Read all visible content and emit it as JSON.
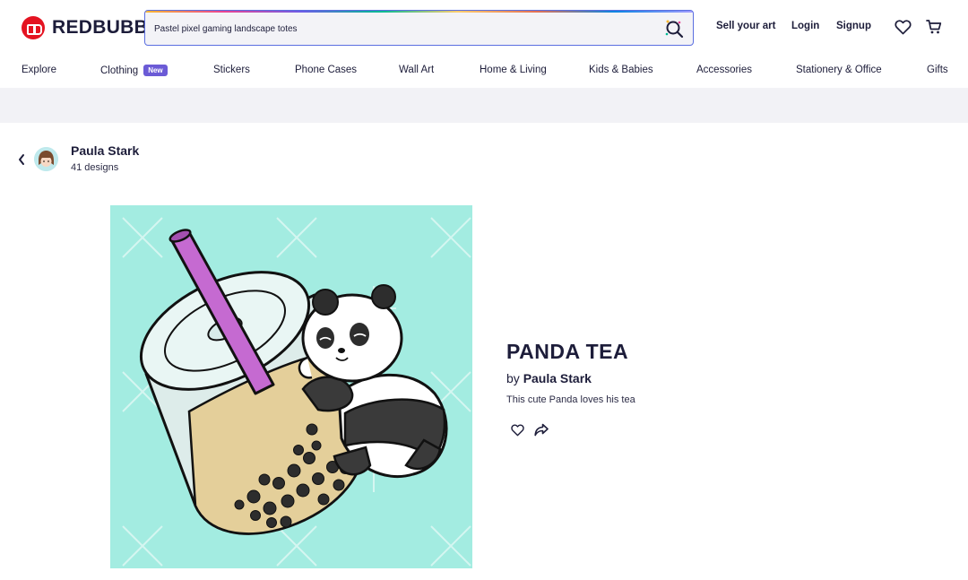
{
  "header": {
    "logo_text": "REDBUBBLE",
    "search_value": "Pastel pixel gaming landscape totes",
    "sell_label": "Sell your art",
    "login_label": "Login",
    "signup_label": "Signup"
  },
  "nav": {
    "items": [
      {
        "label": "Explore"
      },
      {
        "label": "Clothing",
        "badge": "New"
      },
      {
        "label": "Stickers"
      },
      {
        "label": "Phone Cases"
      },
      {
        "label": "Wall Art"
      },
      {
        "label": "Home & Living"
      },
      {
        "label": "Kids & Babies"
      },
      {
        "label": "Accessories"
      },
      {
        "label": "Stationery & Office"
      },
      {
        "label": "Gifts"
      }
    ]
  },
  "artist": {
    "name": "Paula Stark",
    "designs": "41 designs"
  },
  "product": {
    "title": "PANDA TEA",
    "by_prefix": "by",
    "by_artist": "Paula Stark",
    "description": "This cute Panda loves his tea"
  },
  "colors": {
    "brand_red": "#e41321",
    "badge_purple": "#6b5bd6",
    "artwork_bg": "#a3ece1",
    "text_dark": "#1d1d3a"
  },
  "icons": [
    "search-icon",
    "heart-icon",
    "cart-icon",
    "back-chevron-icon",
    "share-icon"
  ]
}
